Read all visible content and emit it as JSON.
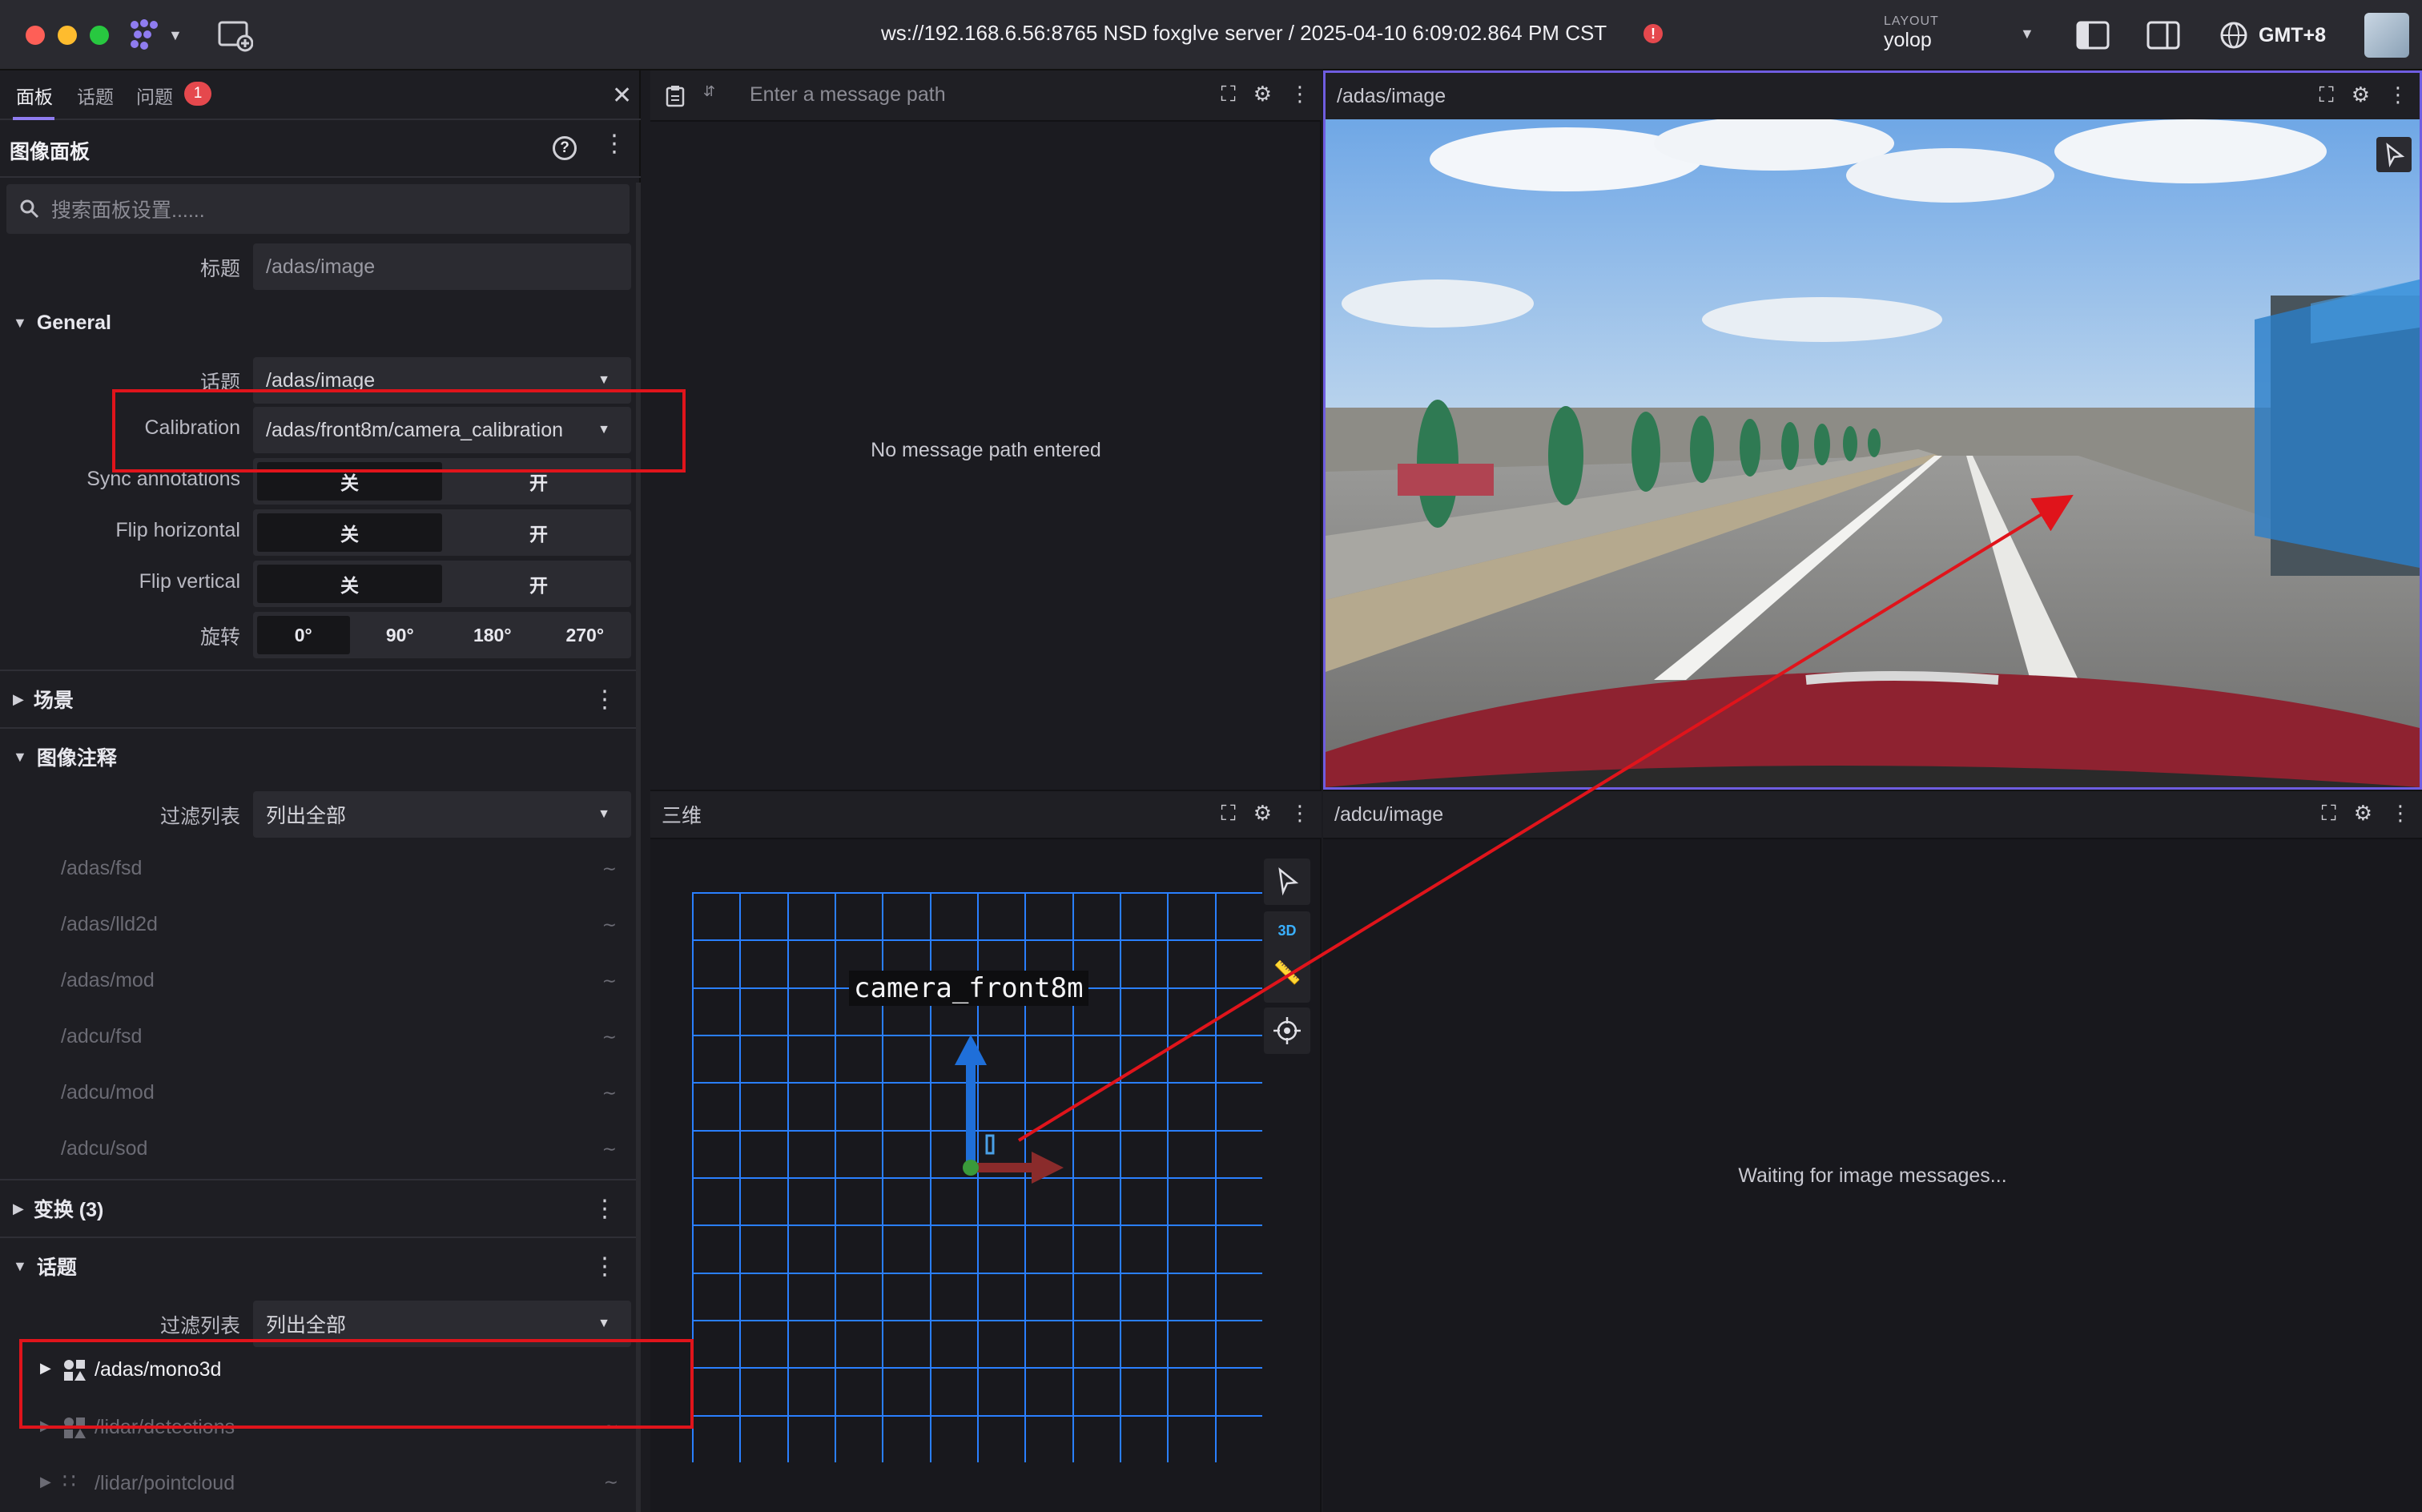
{
  "titlebar": {
    "connection": "ws://192.168.6.56:8765 NSD foxglve server / 2025-04-10 6:09:02.864 PM CST",
    "layout_label": "LAYOUT",
    "layout_name": "yolop",
    "timezone": "GMT+8"
  },
  "sidebar": {
    "tabs": [
      "面板",
      "话题",
      "问题"
    ],
    "problem_count": "1",
    "panel_title": "图像面板",
    "search_placeholder": "搜索面板设置......",
    "title_label": "标题",
    "title_value": "/adas/image",
    "general": {
      "heading": "General",
      "topic_label": "话题",
      "topic_value": "/adas/image",
      "calibration_label": "Calibration",
      "calibration_value": "/adas/front8m/camera_calibration",
      "sync_label": "Sync annotations",
      "flip_h_label": "Flip horizontal",
      "flip_v_label": "Flip vertical",
      "off": "关",
      "on": "开",
      "rotation_label": "旋转",
      "rotation_options": [
        "0°",
        "90°",
        "180°",
        "270°"
      ]
    },
    "scene_heading": "场景",
    "annotations": {
      "heading": "图像注释",
      "filter_label": "过滤列表",
      "filter_value": "列出全部",
      "items": [
        "/adas/fsd",
        "/adas/lld2d",
        "/adas/mod",
        "/adcu/fsd",
        "/adcu/mod",
        "/adcu/sod"
      ]
    },
    "transforms_heading": "变换 (3)",
    "topics": {
      "heading": "话题",
      "filter_label": "过滤列表",
      "filter_value": "列出全部",
      "items": [
        "/adas/mono3d",
        "/lidar/detections",
        "/lidar/pointcloud"
      ]
    }
  },
  "panels": {
    "plot": {
      "placeholder": "Enter a message path",
      "empty": "No message path entered"
    },
    "adas_image": {
      "title": "/adas/image"
    },
    "three_d": {
      "title": "三维",
      "frame_label": "camera_front8m",
      "mode_label": "3D"
    },
    "adcu_image": {
      "title": "/adcu/image",
      "waiting": "Waiting for image messages..."
    }
  },
  "colors": {
    "accent": "#6f5de0",
    "annotation_red": "#e0141b",
    "grid_blue": "#2a7fff",
    "badge_red": "#e5484d"
  }
}
